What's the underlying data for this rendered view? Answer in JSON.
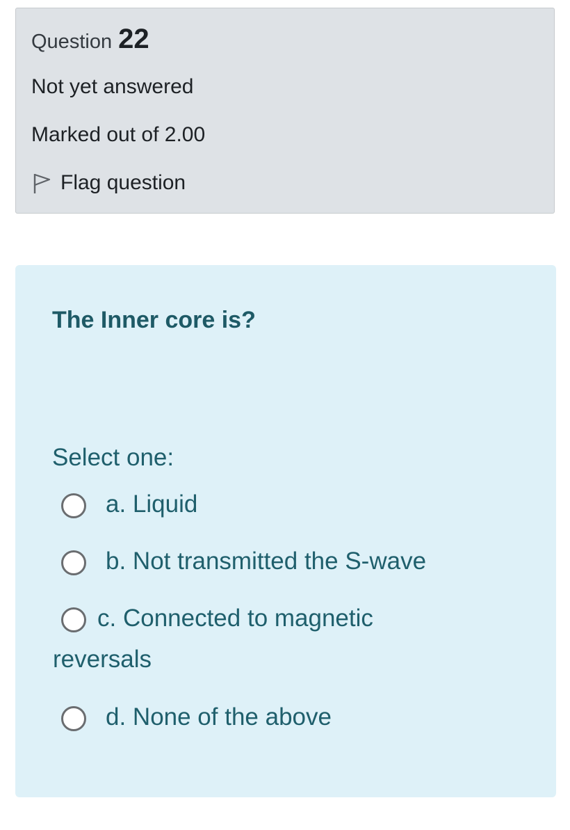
{
  "question_info": {
    "label": "Question",
    "number": "22",
    "state": "Not yet answered",
    "grade": "Marked out of 2.00",
    "flag_label": "Flag question",
    "flag_icon": "flag-outline-icon"
  },
  "formulation": {
    "question_text": "The Inner core is?",
    "prompt": "Select one:",
    "options": [
      {
        "label": "a. Liquid",
        "selected": false
      },
      {
        "label": "b. Not transmitted the S-wave",
        "selected": false
      },
      {
        "label": "c. Connected to magnetic reversals",
        "selected": false
      },
      {
        "label": "d. None of the above",
        "selected": false
      }
    ]
  },
  "colors": {
    "info_background": "#dee2e6",
    "formulation_background": "#def1f8",
    "formulation_text": "#1f5f6c"
  }
}
